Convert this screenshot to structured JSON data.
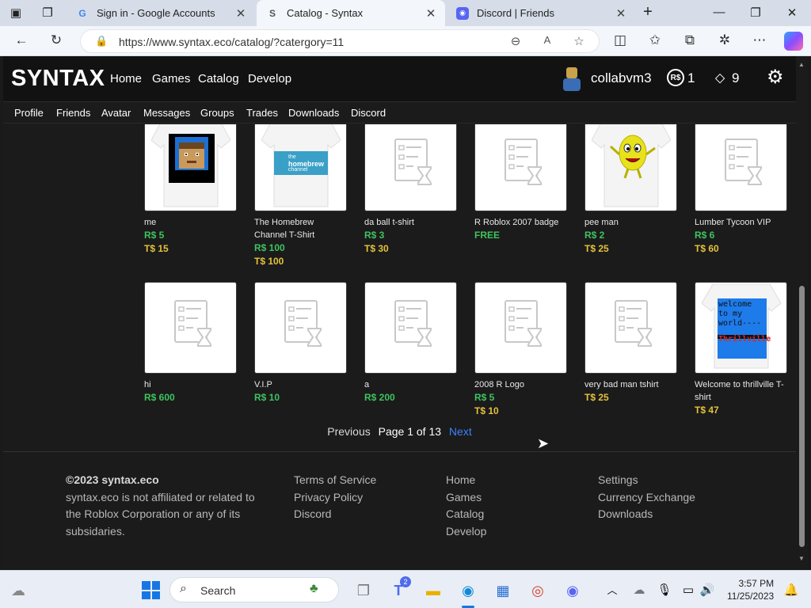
{
  "browser": {
    "tabs": [
      {
        "title": "Sign in - Google Accounts",
        "favicon": "google-icon"
      },
      {
        "title": "Catalog - Syntax",
        "favicon": "syntax-icon"
      },
      {
        "title": "Discord | Friends",
        "favicon": "discord-icon"
      }
    ],
    "url": "https://www.syntax.eco/catalog/?catergory=11"
  },
  "site": {
    "logo": "SYNTAX",
    "nav": [
      "Home",
      "Games",
      "Catalog",
      "Develop"
    ],
    "username": "collabvm3",
    "robux": "1",
    "tix": "9",
    "robux_icon": "R$",
    "subnav": [
      "Profile",
      "Friends",
      "Avatar",
      "Messages",
      "Groups",
      "Trades",
      "Downloads",
      "Discord"
    ]
  },
  "catalog": {
    "row1": [
      {
        "name": "me",
        "robux": "R$ 5",
        "tix": "T$ 15",
        "thumb": "shirt-face"
      },
      {
        "name": "The Homebrew Channel T-Shirt",
        "robux": "R$ 100",
        "tix": "T$ 100",
        "thumb": "shirt-homebrew"
      },
      {
        "name": "da ball t-shirt",
        "robux": "R$ 3",
        "tix": "T$ 30",
        "thumb": "placeholder"
      },
      {
        "name": "R Roblox 2007 badge",
        "robux": "FREE",
        "tix": "",
        "thumb": "placeholder"
      },
      {
        "name": "pee man",
        "robux": "R$ 2",
        "tix": "T$ 25",
        "thumb": "shirt-peeman"
      },
      {
        "name": "Lumber Tycoon VIP",
        "robux": "R$ 6",
        "tix": "T$ 60",
        "thumb": "placeholder"
      }
    ],
    "row2": [
      {
        "name": "hi",
        "robux": "R$ 600",
        "tix": "",
        "thumb": "placeholder"
      },
      {
        "name": "V.I.P",
        "robux": "R$ 10",
        "tix": "",
        "thumb": "placeholder"
      },
      {
        "name": "a",
        "robux": "R$ 200",
        "tix": "",
        "thumb": "placeholder"
      },
      {
        "name": "2008 R Logo",
        "robux": "R$ 5",
        "tix": "T$ 10",
        "thumb": "placeholder"
      },
      {
        "name": "very bad man tshirt",
        "robux": "",
        "tix": "T$ 25",
        "thumb": "placeholder"
      },
      {
        "name": "Welcome to thrillville T-shirt",
        "robux": "",
        "tix": "T$ 47",
        "thumb": "shirt-thrillville"
      }
    ],
    "homebrew_text_1": "the",
    "homebrew_text_2": "homebrew",
    "homebrew_text_3": "channel",
    "thrill_text_1": "welcome",
    "thrill_text_2": "to my",
    "thrill_text_3": "world----",
    "thrill_text_4": "Thrillville"
  },
  "pager": {
    "previous": "Previous",
    "info": "Page 1 of 13",
    "next": "Next"
  },
  "footer": {
    "copyright": "©2023 syntax.eco",
    "disclaimer_1": "syntax.eco is not affiliated or related to",
    "disclaimer_2": "the Roblox Corporation or any of its",
    "disclaimer_3": "subsidaries.",
    "col2": [
      "Terms of Service",
      "Privacy Policy",
      "Discord"
    ],
    "col3": [
      "Home",
      "Games",
      "Catalog",
      "Develop"
    ],
    "col4": [
      "Settings",
      "Currency Exchange",
      "Downloads"
    ]
  },
  "taskbar": {
    "search_label": "Search",
    "teams_badge": "2",
    "time": "3:57 PM",
    "date": "11/25/2023"
  },
  "colors": {
    "robux": "#3ec35f",
    "tix": "#e3c23c",
    "link": "#3b82f6",
    "accent": "#1677e4"
  }
}
